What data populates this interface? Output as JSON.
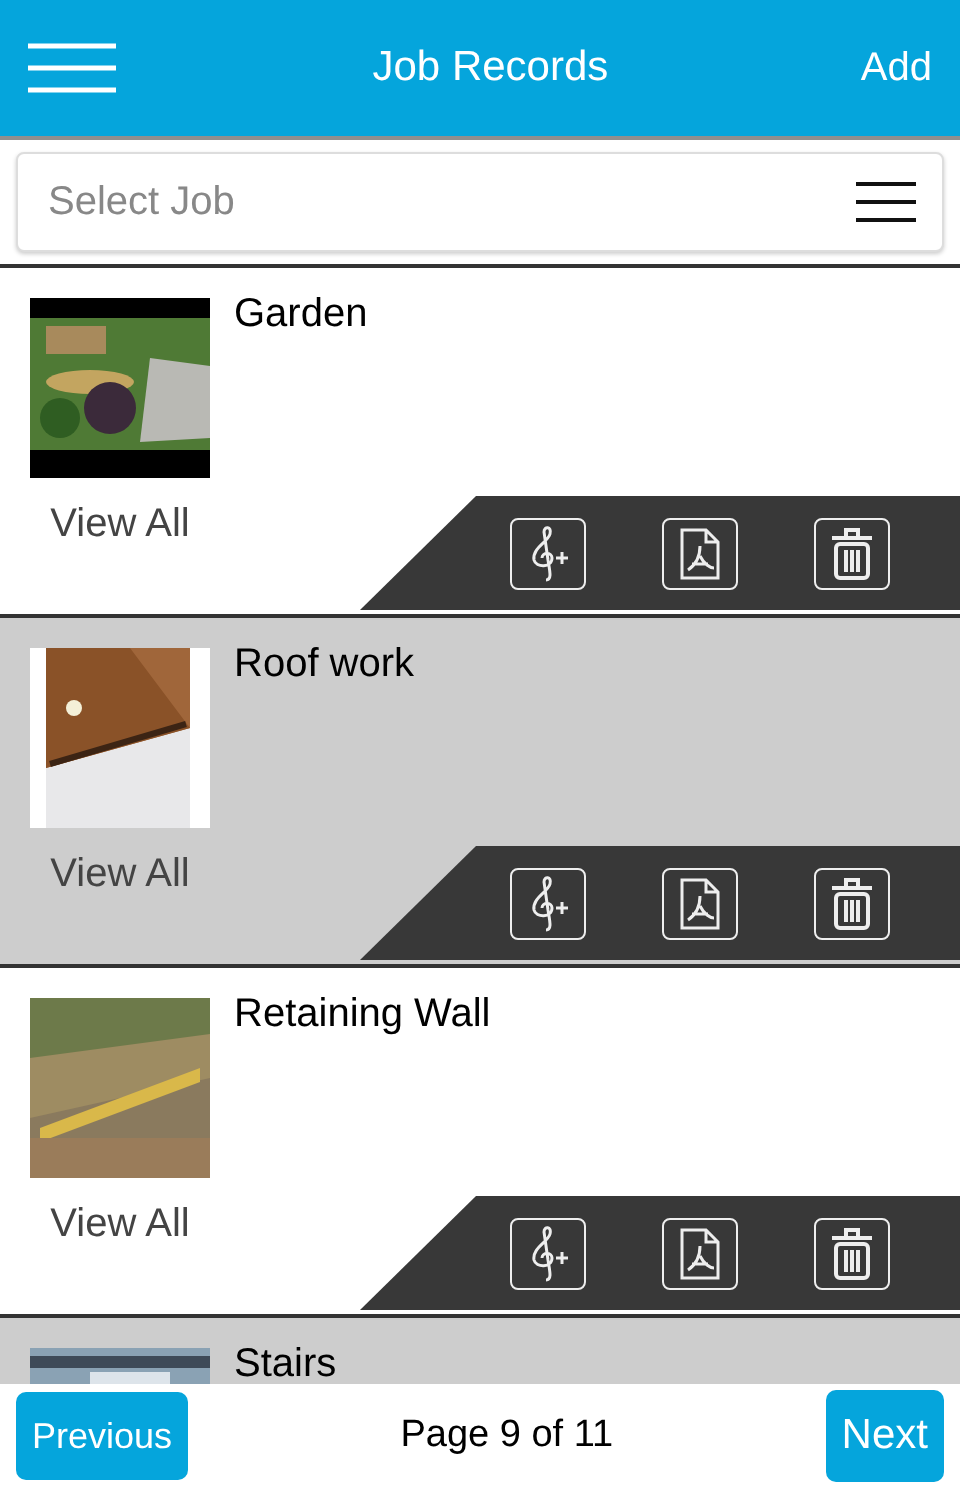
{
  "header": {
    "title": "Job Records",
    "add_label": "Add"
  },
  "job_select": {
    "placeholder": "Select Job"
  },
  "jobs": [
    {
      "name": "Garden",
      "link": "View All"
    },
    {
      "name": "Roof work",
      "link": "View All"
    },
    {
      "name": "Retaining Wall",
      "link": "View All"
    },
    {
      "name": "Stairs"
    }
  ],
  "pager": {
    "previous": "Previous",
    "page": "Page 9 of 11",
    "next": "Next"
  }
}
